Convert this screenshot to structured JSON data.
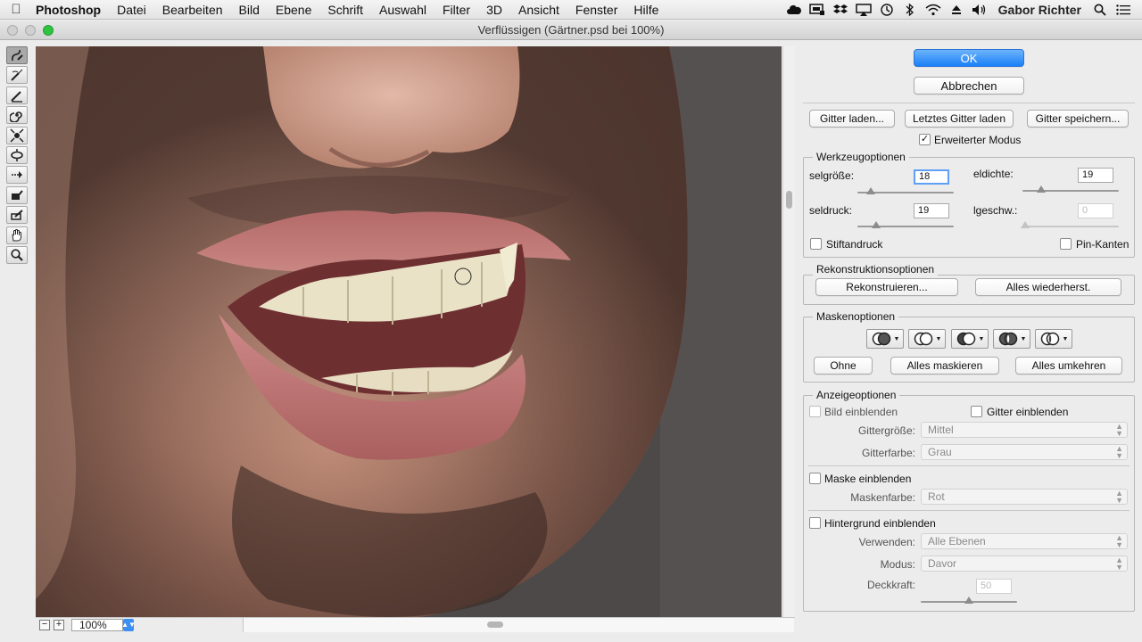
{
  "menubar": {
    "apple": "",
    "items": [
      "Photoshop",
      "Datei",
      "Bearbeiten",
      "Bild",
      "Ebene",
      "Schrift",
      "Auswahl",
      "Filter",
      "3D",
      "Ansicht",
      "Fenster",
      "Hilfe"
    ],
    "user": "Gabor Richter",
    "status_icons": [
      "creative-cloud-icon",
      "display-icon",
      "dropbox-icon",
      "airplay-icon",
      "time-machine-icon",
      "bluetooth-icon",
      "wifi-icon",
      "eject-icon",
      "volume-icon"
    ]
  },
  "window": {
    "title": "Verflüssigen (Gärtner.psd bei 100%)"
  },
  "toolbar": {
    "tools": [
      "forward-warp-tool",
      "reconstruct-tool",
      "smooth-tool",
      "twirl-tool",
      "pucker-tool",
      "bloat-tool",
      "push-left-tool",
      "freeze-mask-tool",
      "thaw-mask-tool",
      "hand-tool",
      "zoom-tool"
    ],
    "active": 0
  },
  "bottom": {
    "zoom_out": "−",
    "zoom_in": "+",
    "zoom": "100%"
  },
  "panel": {
    "ok": "OK",
    "cancel": "Abbrechen",
    "mesh": {
      "load": "Gitter laden...",
      "load_last": "Letztes Gitter laden",
      "save": "Gitter speichern..."
    },
    "advanced_mode": {
      "label": "Erweiterter Modus",
      "checked": "✓"
    },
    "tool_options": {
      "title": "Werkzeugoptionen",
      "brush_size_label": "selgröße:",
      "brush_size": "18",
      "brush_density_label": "eldichte:",
      "brush_density": "19",
      "brush_pressure_label": "seldruck:",
      "brush_pressure": "19",
      "brush_rate_label": "lgeschw.:",
      "brush_rate": "0",
      "stylus_label": "Stiftandruck",
      "pin_edges_label": "Pin-Kanten"
    },
    "reconstruct": {
      "title": "Rekonstruktionsoptionen",
      "reconstruct": "Rekonstruieren...",
      "restore_all": "Alles wiederherst."
    },
    "mask": {
      "title": "Maskenoptionen",
      "none": "Ohne",
      "mask_all": "Alles maskieren",
      "invert_all": "Alles umkehren"
    },
    "view": {
      "title": "Anzeigeoptionen",
      "show_image": "Bild einblenden",
      "show_mesh": "Gitter einblenden",
      "mesh_size_label": "Gittergröße:",
      "mesh_size": "Mittel",
      "mesh_color_label": "Gitterfarbe:",
      "mesh_color": "Grau",
      "show_mask": "Maske einblenden",
      "mask_color_label": "Maskenfarbe:",
      "mask_color": "Rot",
      "show_backdrop": "Hintergrund einblenden",
      "use_label": "Verwenden:",
      "use": "Alle Ebenen",
      "mode_label": "Modus:",
      "mode": "Davor",
      "opacity_label": "Deckkraft:",
      "opacity": "50"
    }
  },
  "colors": {
    "accent": "#1b80f7",
    "focus": "#5f9ff6"
  }
}
